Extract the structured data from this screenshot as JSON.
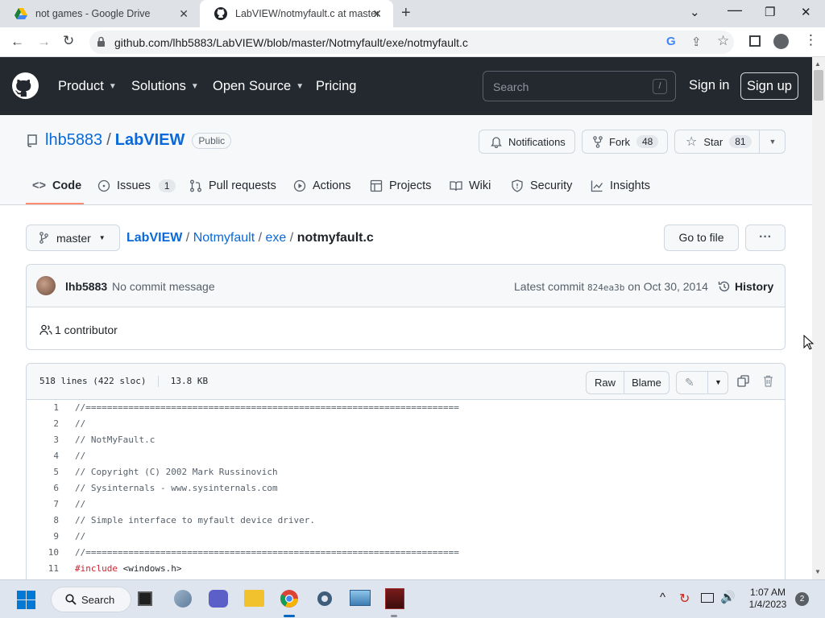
{
  "browser": {
    "tabs": [
      {
        "title": "not games - Google Drive"
      },
      {
        "title": "LabVIEW/notmyfault.c at master"
      }
    ],
    "url": "github.com/lhb5883/LabVIEW/blob/master/Notmyfault/exe/notmyfault.c"
  },
  "github_header": {
    "nav": [
      "Product",
      "Solutions",
      "Open Source",
      "Pricing"
    ],
    "search_placeholder": "Search",
    "search_shortcut": "/",
    "sign_in": "Sign in",
    "sign_up": "Sign up"
  },
  "repo": {
    "owner": "lhb5883",
    "separator": "/",
    "name": "LabVIEW",
    "visibility": "Public",
    "notifications_label": "Notifications",
    "fork_label": "Fork",
    "fork_count": "48",
    "star_label": "Star",
    "star_count": "81",
    "tabs": [
      {
        "label": "Code",
        "icon": "code-icon"
      },
      {
        "label": "Issues",
        "icon": "issue-icon",
        "count": "1"
      },
      {
        "label": "Pull requests",
        "icon": "pull-request-icon"
      },
      {
        "label": "Actions",
        "icon": "play-icon"
      },
      {
        "label": "Projects",
        "icon": "table-icon"
      },
      {
        "label": "Wiki",
        "icon": "book-icon"
      },
      {
        "label": "Security",
        "icon": "shield-icon"
      },
      {
        "label": "Insights",
        "icon": "graph-icon"
      }
    ]
  },
  "file": {
    "branch": "master",
    "breadcrumb": [
      "LabVIEW",
      "Notmyfault",
      "exe"
    ],
    "filename": "notmyfault.c",
    "go_to_file": "Go to file",
    "more": "···",
    "commit_author": "lhb5883",
    "commit_message": "No commit message",
    "latest_commit_label": "Latest commit",
    "commit_sha": "824ea3b",
    "commit_date": "on Oct 30, 2014",
    "history_label": "History",
    "contributors": "1 contributor",
    "lines_info": "518 lines (422 sloc)",
    "size": "13.8 KB",
    "raw_label": "Raw",
    "blame_label": "Blame"
  },
  "code_lines": [
    {
      "n": "1",
      "text": "//======================================================================"
    },
    {
      "n": "2",
      "text": "//"
    },
    {
      "n": "3",
      "text": "// NotMyFault.c"
    },
    {
      "n": "4",
      "text": "//"
    },
    {
      "n": "5",
      "text": "// Copyright (C) 2002 Mark Russinovich"
    },
    {
      "n": "6",
      "text": "// Sysinternals - www.sysinternals.com"
    },
    {
      "n": "7",
      "text": "//"
    },
    {
      "n": "8",
      "text": "// Simple interface to myfault device driver."
    },
    {
      "n": "9",
      "text": "//"
    },
    {
      "n": "10",
      "text": "//======================================================================"
    },
    {
      "n": "11",
      "kw": "#include",
      "text": " <windows.h>"
    }
  ],
  "taskbar": {
    "search_label": "Search",
    "time": "1:07 AM",
    "date": "1/4/2023",
    "notification_count": "2"
  },
  "colors": {
    "github_header_bg": "#24292f",
    "link_blue": "#0969da",
    "tab_underline": "#fd8c73"
  }
}
